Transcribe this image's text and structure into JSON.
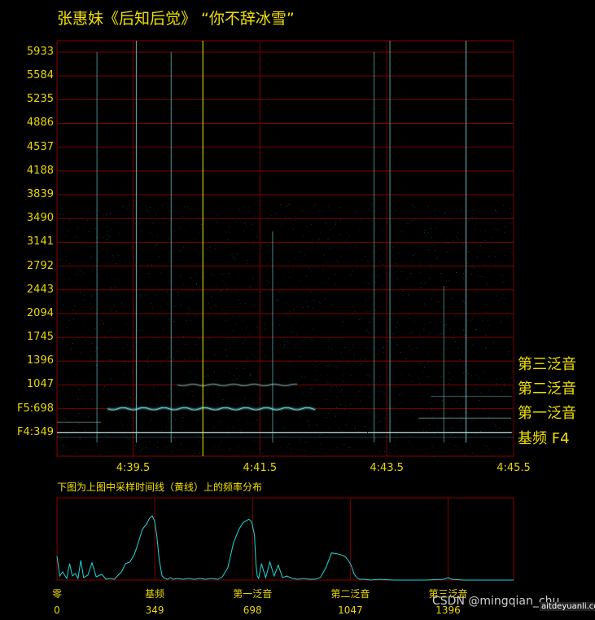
{
  "title": "张惠妹《后知后觉》 “你不辞冰雪”",
  "caption": "下图为上图中采样时间线（黄线）上的频率分布",
  "annotations": [
    "第三泛音",
    "第二泛音",
    "第一泛音",
    "基频 F4"
  ],
  "watermark": {
    "csdn": "CSDN @mingqian_chu",
    "site": "aitdeyuanli.com"
  },
  "colors": {
    "trace": "#20d8d8",
    "grid": "#7a0000",
    "text": "#e8d800",
    "cursor": "#f0f000"
  },
  "chart_data": [
    {
      "type": "heatmap",
      "title": "张惠妹《后知后觉》 “你不辞冰雪”",
      "y_tick_labels": [
        "F4:349",
        "F5:698",
        "1047",
        "1396",
        "1745",
        "2094",
        "2443",
        "2792",
        "3141",
        "3490",
        "3839",
        "4188",
        "4537",
        "4886",
        "5235",
        "5584",
        "5933"
      ],
      "y_values": [
        349,
        698,
        1047,
        1396,
        1745,
        2094,
        2443,
        2792,
        3141,
        3490,
        3839,
        4188,
        4537,
        4886,
        5235,
        5584,
        5933
      ],
      "ylim": [
        0,
        6100
      ],
      "x_tick_labels": [
        "4:39.5",
        "4:41.5",
        "4:43.5",
        "4:45.5"
      ],
      "x_values_s": [
        279.5,
        281.5,
        283.5,
        285.5
      ],
      "xlim_s": [
        278.3,
        285.5
      ],
      "cursor_time_s": 280.6,
      "grid": true,
      "harmonics": [
        {
          "name": "基频 F4",
          "hz": 349
        },
        {
          "name": "第一泛音",
          "hz": 698
        },
        {
          "name": "第二泛音",
          "hz": 1047
        },
        {
          "name": "第三泛音",
          "hz": 1396
        }
      ]
    },
    {
      "type": "line",
      "x_tick_labels": [
        "零",
        "基频",
        "第一泛音",
        "第二泛音",
        "第三泛音"
      ],
      "x_values": [
        0,
        349,
        698,
        1047,
        1396
      ],
      "xlim": [
        0,
        1630
      ],
      "ylim": [
        0,
        1
      ],
      "grid": true,
      "series": [
        {
          "x": [
            0,
            10,
            20,
            35,
            45,
            55,
            65,
            75,
            85,
            95,
            110,
            125,
            140,
            160,
            175,
            190,
            205,
            215,
            230,
            245,
            260,
            275,
            290,
            305,
            320,
            330,
            340,
            348,
            356,
            365,
            375,
            385,
            395,
            405,
            415,
            430,
            450,
            470,
            490,
            510,
            530,
            550,
            575,
            590,
            610,
            630,
            650,
            665,
            675,
            685,
            695,
            705,
            710,
            715,
            720,
            730,
            745,
            760,
            775,
            790,
            805,
            820,
            840,
            860,
            880,
            900,
            920,
            940,
            960,
            980,
            1000,
            1010,
            1020,
            1030,
            1040,
            1050,
            1060,
            1070,
            1080,
            1090,
            1100,
            1120,
            1150,
            1200,
            1260,
            1320,
            1380,
            1396,
            1410,
            1450,
            1500,
            1560,
            1630
          ],
          "y": [
            0.29,
            0.05,
            0.1,
            0.02,
            0.2,
            0.05,
            0.08,
            0.02,
            0.24,
            0.03,
            0.06,
            0.21,
            0.04,
            0.07,
            0.01,
            0.02,
            0.01,
            0.05,
            0.1,
            0.2,
            0.22,
            0.3,
            0.45,
            0.62,
            0.68,
            0.75,
            0.78,
            0.72,
            0.55,
            0.25,
            0.05,
            0.02,
            0.01,
            0.03,
            0.01,
            0.02,
            0.01,
            0.02,
            0.01,
            0.02,
            0.01,
            0.02,
            0.01,
            0.04,
            0.15,
            0.45,
            0.62,
            0.7,
            0.72,
            0.74,
            0.71,
            0.55,
            0.2,
            0.05,
            0.02,
            0.2,
            0.03,
            0.22,
            0.05,
            0.18,
            0.03,
            0.05,
            0.02,
            0.01,
            0.02,
            0.01,
            0.01,
            0.03,
            0.15,
            0.33,
            0.32,
            0.31,
            0.3,
            0.28,
            0.24,
            0.18,
            0.08,
            0.03,
            0.01,
            0.01,
            0.01,
            0.0,
            0.01,
            0.0,
            0.0,
            0.0,
            0.01,
            0.03,
            0.01,
            0.0,
            0.0,
            0.0,
            0.0
          ]
        }
      ]
    }
  ]
}
